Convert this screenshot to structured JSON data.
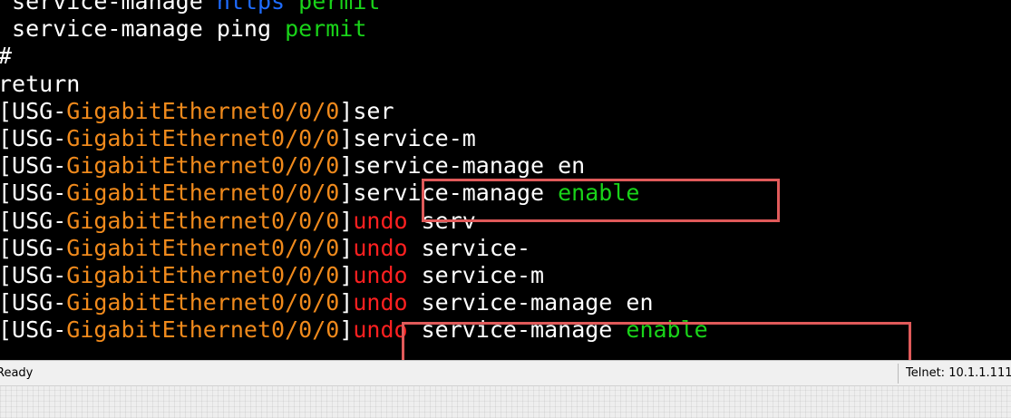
{
  "colors": {
    "terminal_bg": "#000000",
    "text_default": "#ffffff",
    "keyword_blue": "#1e6cff",
    "keyword_green": "#19d319",
    "interface_orange": "#f08a1c",
    "undo_red": "#ff2020",
    "highlight_box": "#e05a5a"
  },
  "terminal": {
    "lines": [
      {
        "segments": [
          {
            "text": " service-manage ",
            "color": "default"
          },
          {
            "text": "https",
            "color": "blue"
          },
          {
            "text": " ",
            "color": "default"
          },
          {
            "text": "permit",
            "color": "green"
          }
        ]
      },
      {
        "segments": [
          {
            "text": " service-manage ping ",
            "color": "default"
          },
          {
            "text": "permit",
            "color": "green"
          }
        ]
      },
      {
        "segments": [
          {
            "text": "#",
            "color": "default"
          }
        ]
      },
      {
        "segments": [
          {
            "text": "return",
            "color": "default"
          }
        ]
      },
      {
        "segments": [
          {
            "text": "[USG-",
            "color": "default"
          },
          {
            "text": "GigabitEthernet0/0/0",
            "color": "orange"
          },
          {
            "text": "]ser",
            "color": "default"
          }
        ]
      },
      {
        "segments": [
          {
            "text": "[USG-",
            "color": "default"
          },
          {
            "text": "GigabitEthernet0/0/0",
            "color": "orange"
          },
          {
            "text": "]service-m",
            "color": "default"
          }
        ]
      },
      {
        "segments": [
          {
            "text": "[USG-",
            "color": "default"
          },
          {
            "text": "GigabitEthernet0/0/0",
            "color": "orange"
          },
          {
            "text": "]service-manage en",
            "color": "default"
          }
        ]
      },
      {
        "segments": [
          {
            "text": "[USG-",
            "color": "default"
          },
          {
            "text": "GigabitEthernet0/0/0",
            "color": "orange"
          },
          {
            "text": "]service-manage ",
            "color": "default"
          },
          {
            "text": "enable",
            "color": "green"
          }
        ]
      },
      {
        "segments": [
          {
            "text": "[USG-",
            "color": "default"
          },
          {
            "text": "GigabitEthernet0/0/0",
            "color": "orange"
          },
          {
            "text": "]",
            "color": "default"
          },
          {
            "text": "undo",
            "color": "red"
          },
          {
            "text": " serv",
            "color": "default"
          }
        ]
      },
      {
        "segments": [
          {
            "text": "[USG-",
            "color": "default"
          },
          {
            "text": "GigabitEthernet0/0/0",
            "color": "orange"
          },
          {
            "text": "]",
            "color": "default"
          },
          {
            "text": "undo",
            "color": "red"
          },
          {
            "text": " service-",
            "color": "default"
          }
        ]
      },
      {
        "segments": [
          {
            "text": "[USG-",
            "color": "default"
          },
          {
            "text": "GigabitEthernet0/0/0",
            "color": "orange"
          },
          {
            "text": "]",
            "color": "default"
          },
          {
            "text": "undo",
            "color": "red"
          },
          {
            "text": " service-m",
            "color": "default"
          }
        ]
      },
      {
        "segments": [
          {
            "text": "[USG-",
            "color": "default"
          },
          {
            "text": "GigabitEthernet0/0/0",
            "color": "orange"
          },
          {
            "text": "]",
            "color": "default"
          },
          {
            "text": "undo",
            "color": "red"
          },
          {
            "text": " service-manage en",
            "color": "default"
          }
        ]
      },
      {
        "segments": [
          {
            "text": "[USG-",
            "color": "default"
          },
          {
            "text": "GigabitEthernet0/0/0",
            "color": "orange"
          },
          {
            "text": "]",
            "color": "default"
          },
          {
            "text": "undo",
            "color": "red"
          },
          {
            "text": " service-manage ",
            "color": "default"
          },
          {
            "text": "enable",
            "color": "green"
          }
        ]
      }
    ]
  },
  "statusbar": {
    "left_text": "Ready",
    "right_text": "Telnet: 10.1.1.111"
  }
}
